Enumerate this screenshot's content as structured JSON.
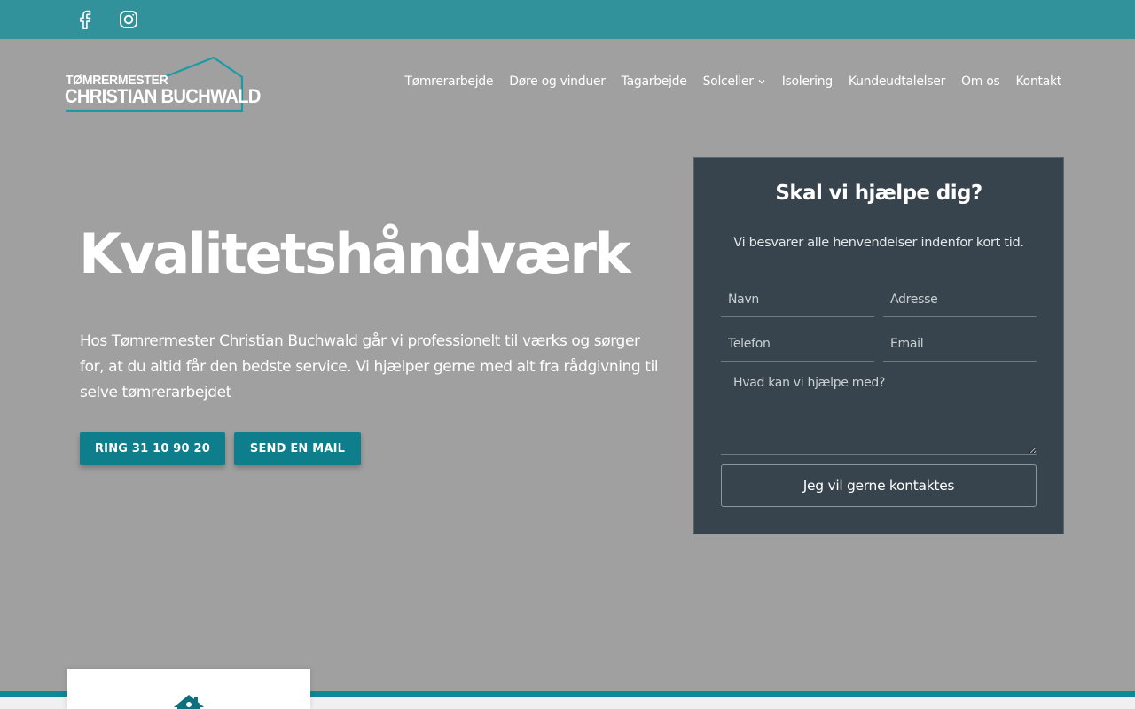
{
  "topbar": {
    "social": [
      {
        "icon": "facebook-icon"
      },
      {
        "icon": "instagram-icon"
      }
    ]
  },
  "logo": {
    "line1": "TØMRERMESTER",
    "line2": "CHRISTIAN BUCHWALD"
  },
  "nav": {
    "items": [
      {
        "label": "Tømrerarbejde"
      },
      {
        "label": "Døre og vinduer"
      },
      {
        "label": "Tagarbejde"
      },
      {
        "label": "Solceller"
      },
      {
        "label": "Isolering"
      },
      {
        "label": "Kundeudtalelser"
      },
      {
        "label": "Om os"
      },
      {
        "label": "Kontakt"
      }
    ]
  },
  "hero": {
    "title": "Kvalitetshåndværk",
    "text": "Hos Tømrermester Christian Buchwald går vi professionelt til værks og sørger for, at du altid får den bedste service. Vi hjælper gerne med alt fra rådgivning til selve tømrerarbejdet",
    "call_button": "RING 31 10 90 20",
    "mail_button": "SEND EN MAIL"
  },
  "form": {
    "title": "Skal vi hjælpe dig?",
    "subtitle": "Vi besvarer alle henvendelser indenfor kort tid.",
    "name_placeholder": "Navn",
    "address_placeholder": "Adresse",
    "phone_placeholder": "Telefon",
    "email_placeholder": "Email",
    "message_placeholder": "Hvad kan vi hjælpe med?",
    "submit_label": "Jeg vil gerne kontaktes"
  },
  "colors": {
    "topbar": "#32929c",
    "accent": "#0e7d8c",
    "form_bg": "#37444d",
    "hero_bg": "#a0a0a0"
  }
}
